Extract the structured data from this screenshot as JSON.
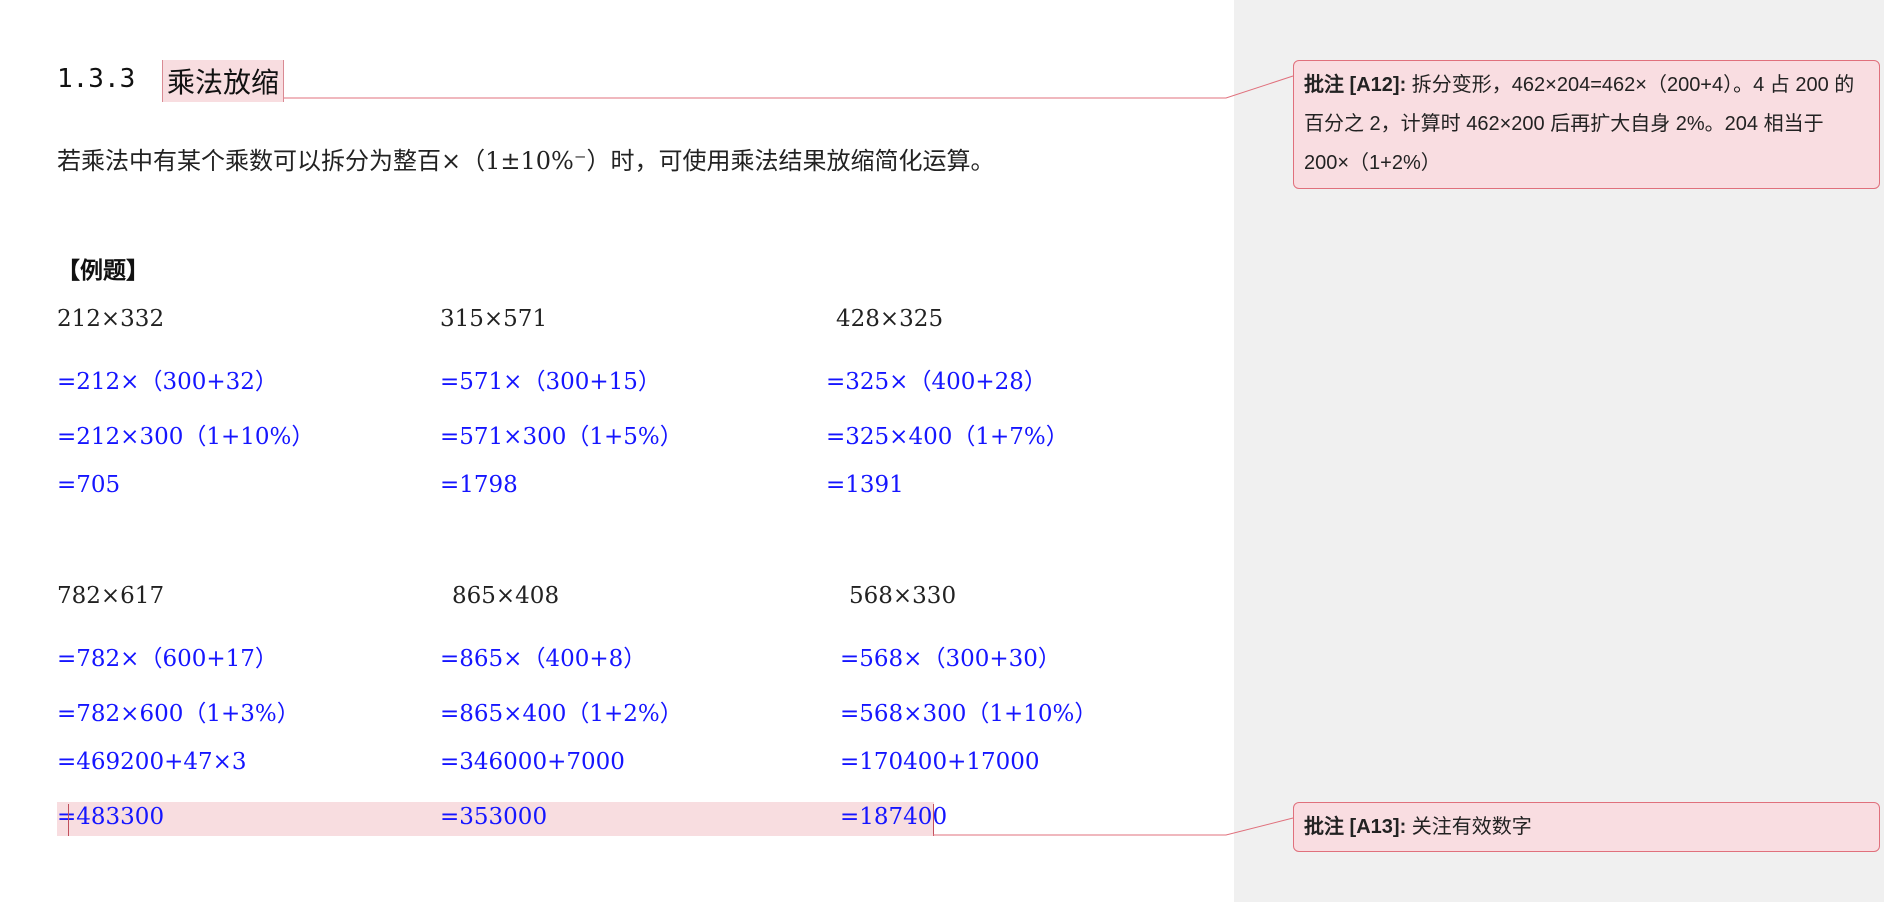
{
  "section": {
    "number": "1.3.3",
    "title": "乘法放缩",
    "intro": "若乘法中有某个乘数可以拆分为整百×（1±10%⁻）时，可使用乘法结果放缩简化运算。"
  },
  "example_label": "【例题】",
  "examples": [
    {
      "problem": "212×332",
      "steps": [
        "=212×（300+32）",
        "=212×300（1+10%）",
        "=705"
      ]
    },
    {
      "problem": "315×571",
      "steps": [
        "=571×（300+15）",
        "=571×300（1+5%）",
        "=1798"
      ]
    },
    {
      "problem": "428×325",
      "steps": [
        "=325×（400+28）",
        "=325×400（1+7%）",
        "=1391"
      ]
    },
    {
      "problem": "782×617",
      "steps": [
        "=782×（600+17）",
        "=782×600（1+3%）",
        "=469200+47×3",
        "=483300"
      ]
    },
    {
      "problem": "865×408",
      "steps": [
        "=865×（400+8）",
        "=865×400（1+2%）",
        "=346000+7000",
        "=353000"
      ]
    },
    {
      "problem": "568×330",
      "steps": [
        "=568×（300+30）",
        "=568×300（1+10%）",
        "=170400+17000",
        "=187400"
      ]
    }
  ],
  "comments": [
    {
      "author": "批注 [A12]:",
      "text": "拆分变形，462×204=462×（200+4）。4 占 200 的百分之 2，计算时 462×200 后再扩大自身 2%。204 相当于 200×（1+2%）"
    },
    {
      "author": "批注 [A13]:",
      "text": "关注有效数字"
    }
  ],
  "colors": {
    "answer_blue": "#1515ff",
    "comment_fill": "#f9dde1",
    "comment_border": "#e0707c",
    "highlight": "#f8dde0"
  }
}
